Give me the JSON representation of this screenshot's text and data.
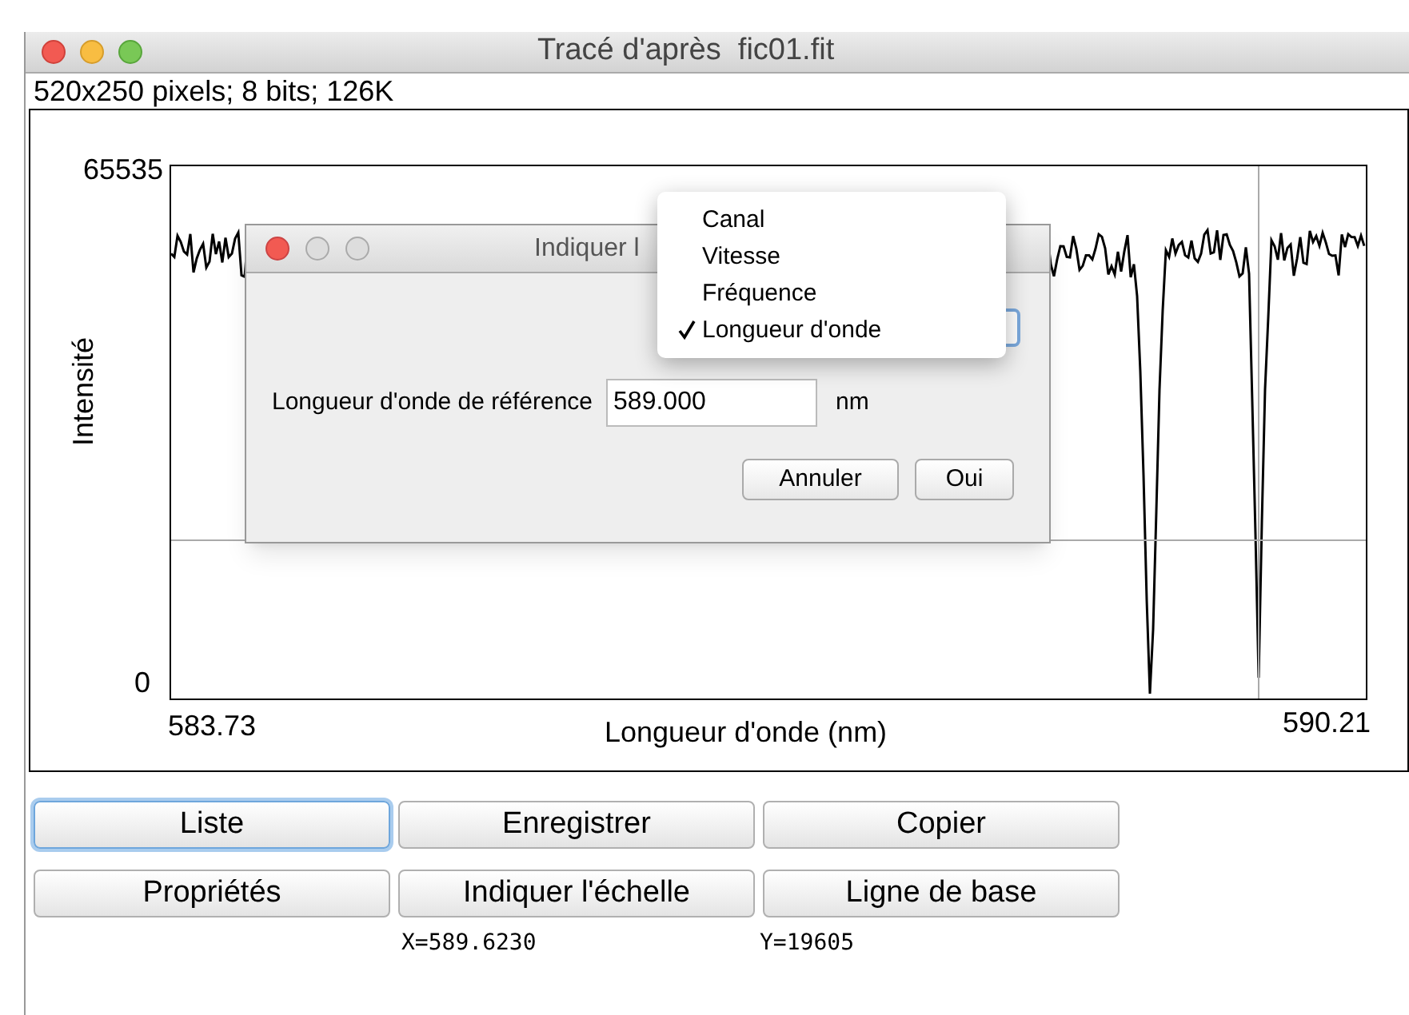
{
  "window": {
    "title": "Tracé d'après  fic01.fit"
  },
  "info": "520x250 pixels; 8 bits; 126K",
  "plot": {
    "y_max": "65535",
    "y_min": "0",
    "x_min": "583.73",
    "x_max": "590.21",
    "xlabel": "Longueur d'onde (nm)",
    "ylabel": "Intensité"
  },
  "dialog": {
    "title": "Indiquer l",
    "field_label": "Longueur d'onde de référence",
    "field_value": "589.000",
    "unit": "nm",
    "buttons": [
      "Annuler",
      "Oui"
    ]
  },
  "menu": [
    {
      "label": "Canal",
      "selected": false
    },
    {
      "label": "Vitesse",
      "selected": false
    },
    {
      "label": "Fréquence",
      "selected": false
    },
    {
      "label": "Longueur d'onde",
      "selected": true
    }
  ],
  "buttons": [
    {
      "label": "Liste",
      "focused": true
    },
    {
      "label": "Enregistrer",
      "focused": false
    },
    {
      "label": "Copier",
      "focused": false
    },
    {
      "label": "Propriétés",
      "focused": false
    },
    {
      "label": "Indiquer l'échelle",
      "focused": false
    },
    {
      "label": "Ligne de base",
      "focused": false
    }
  ],
  "status": {
    "x": "X=589.6230",
    "y": "Y=19605"
  }
}
